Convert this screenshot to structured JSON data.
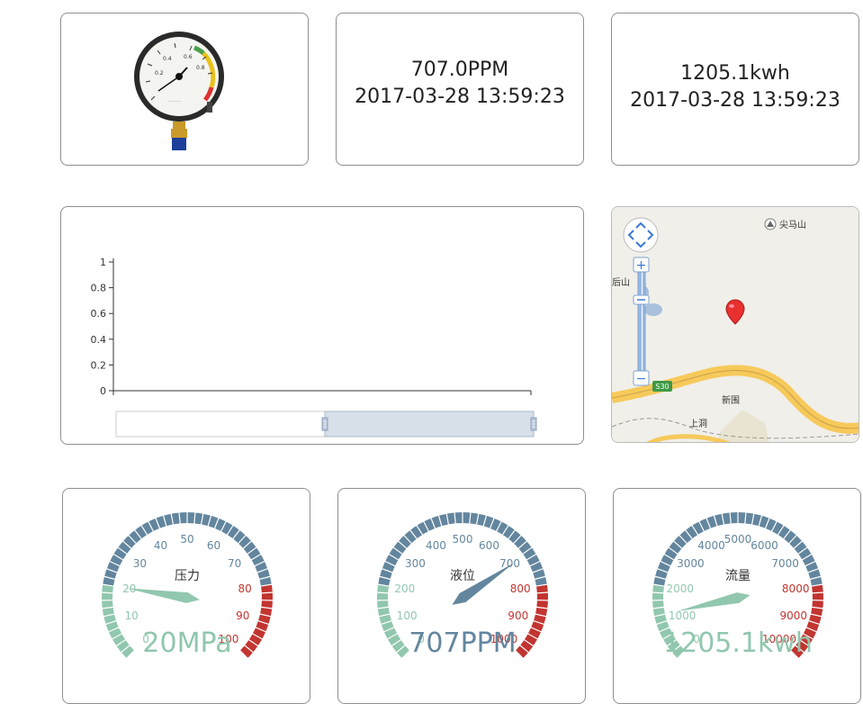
{
  "pressure_card": {
    "image": "pressure-gauge-photo"
  },
  "level_card": {
    "value": "707.0PPM",
    "time": "2017-03-28 13:59:23"
  },
  "energy_card": {
    "value": "1205.1kwh",
    "time": "2017-03-28 13:59:23"
  },
  "line_chart": {
    "chart_data": {
      "type": "line",
      "title": "",
      "xlabel": "",
      "ylabel": "",
      "x": [],
      "series": [],
      "ylim": [
        0,
        1
      ],
      "yticks": [
        "0",
        "0.2",
        "0.4",
        "0.6",
        "0.8",
        "1"
      ],
      "datazoom": {
        "start": 0.5,
        "end": 1.0
      }
    }
  },
  "map": {
    "labels": {
      "peak": "尖马山",
      "left": "后山",
      "new": "新围",
      "village": "上洞",
      "road": "S30"
    },
    "controls": {
      "zoom_in": "+",
      "zoom_out": "−"
    }
  },
  "gauges": [
    {
      "title": "压力",
      "value": 20,
      "min": 0,
      "max": 100,
      "unit": "MPa",
      "display": "20MPa",
      "ticks": [
        "0",
        "10",
        "20",
        "30",
        "40",
        "50",
        "60",
        "70",
        "80",
        "90",
        "100"
      ],
      "value_color": "#91c7ae"
    },
    {
      "title": "液位",
      "value": 707,
      "min": 0,
      "max": 1000,
      "unit": "PPM",
      "display": "707PPM",
      "ticks": [
        "0",
        "100",
        "200",
        "300",
        "400",
        "500",
        "600",
        "700",
        "800",
        "900",
        "1000"
      ],
      "value_color": "#63869e"
    },
    {
      "title": "流量",
      "value": 1205.1,
      "min": 0,
      "max": 10000,
      "unit": "kwh",
      "display": "1205.1kwh",
      "ticks": [
        "0",
        "1000",
        "2000",
        "3000",
        "4000",
        "5000",
        "6000",
        "7000",
        "8000",
        "9000",
        "10000"
      ],
      "value_color": "#91c7ae"
    }
  ],
  "colors": {
    "low": "#91c7ae",
    "mid": "#63869e",
    "high": "#c23531"
  }
}
